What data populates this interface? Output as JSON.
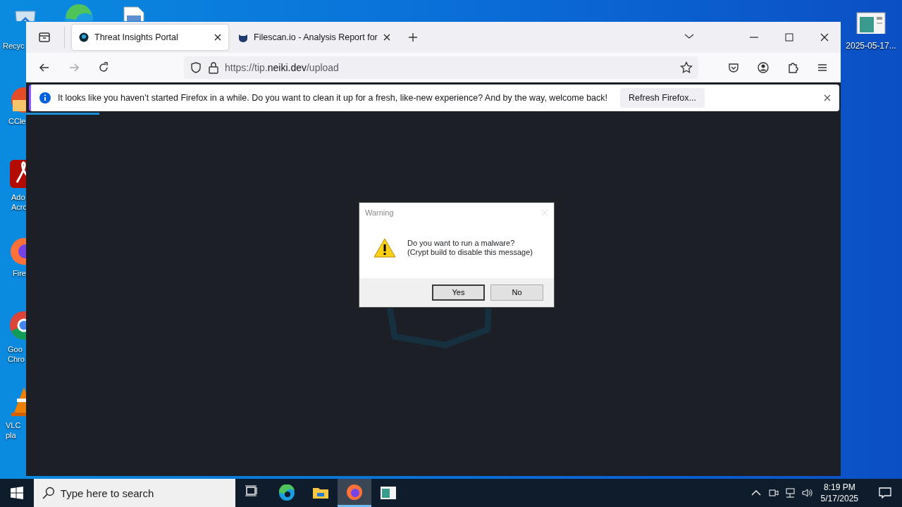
{
  "desktop_icons": [
    {
      "kind": "recycle",
      "lines": [
        "Recyc"
      ]
    },
    {
      "kind": "edge"
    },
    {
      "kind": "document"
    },
    {
      "kind": "ccleaner",
      "lines": [
        "CCle"
      ]
    },
    {
      "kind": "acrobat",
      "lines": [
        "Ado",
        "Acro"
      ]
    },
    {
      "kind": "firefox",
      "lines": [
        "Fire"
      ]
    },
    {
      "kind": "chrome",
      "lines": [
        "Goo",
        "Chro"
      ]
    },
    {
      "kind": "vlc",
      "lines": [
        "VLC",
        "pla"
      ]
    },
    {
      "kind": "screenshot",
      "lines": [
        "2025-05-17..."
      ]
    }
  ],
  "browser": {
    "tabs": [
      {
        "title": "Threat Insights Portal",
        "selected": true,
        "kind": "portal"
      },
      {
        "title": "Filescan.io - Analysis Report for",
        "selected": false,
        "kind": "filescan"
      }
    ],
    "url": {
      "host_before": "https://tip.",
      "domain": "neiki.dev",
      "path": "/upload"
    },
    "notification": {
      "message": "It looks like you haven’t started Firefox in a while. Do you want to clean it up for a fresh, like-new experience? And by the way, welcome back!",
      "button": "Refresh Firefox..."
    },
    "loading": {
      "level": 0.09
    }
  },
  "dialog": {
    "title": "Warning",
    "lines": [
      "Do you want to run a malware?",
      "(Crypt build to disable this message)"
    ],
    "buttons": [
      {
        "label": "Yes",
        "selected": true
      },
      {
        "label": "No",
        "selected": false
      }
    ]
  },
  "taskbar": {
    "search_placeholder": "Type here to search",
    "apps": [
      {
        "kind": "taskview",
        "active": false
      },
      {
        "kind": "edge",
        "active": false
      },
      {
        "kind": "explorer",
        "active": false
      },
      {
        "kind": "firefox",
        "active": true
      },
      {
        "kind": "screenshot",
        "active": false
      }
    ],
    "time": "8:19 PM",
    "date": "5/17/2025"
  }
}
